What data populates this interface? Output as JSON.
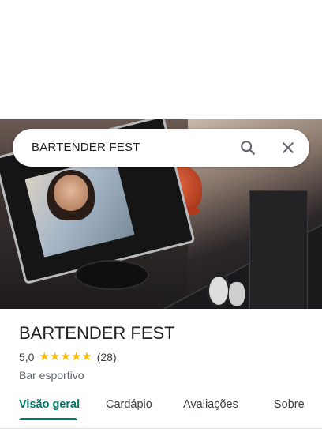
{
  "search": {
    "query": "BARTENDER FEST"
  },
  "place": {
    "name": "BARTENDER FEST",
    "rating": "5,0",
    "stars": 5,
    "review_count": "(28)",
    "category": "Bar esportivo"
  },
  "tabs": [
    {
      "label": "Visão geral",
      "active": true
    },
    {
      "label": "Cardápio",
      "active": false
    },
    {
      "label": "Avaliações",
      "active": false
    },
    {
      "label": "Sobre",
      "active": false
    }
  ],
  "colors": {
    "accent": "#00796b",
    "star": "#fbbc04"
  },
  "icons": {
    "search": "search-icon",
    "close": "close-icon",
    "star": "star-icon"
  }
}
